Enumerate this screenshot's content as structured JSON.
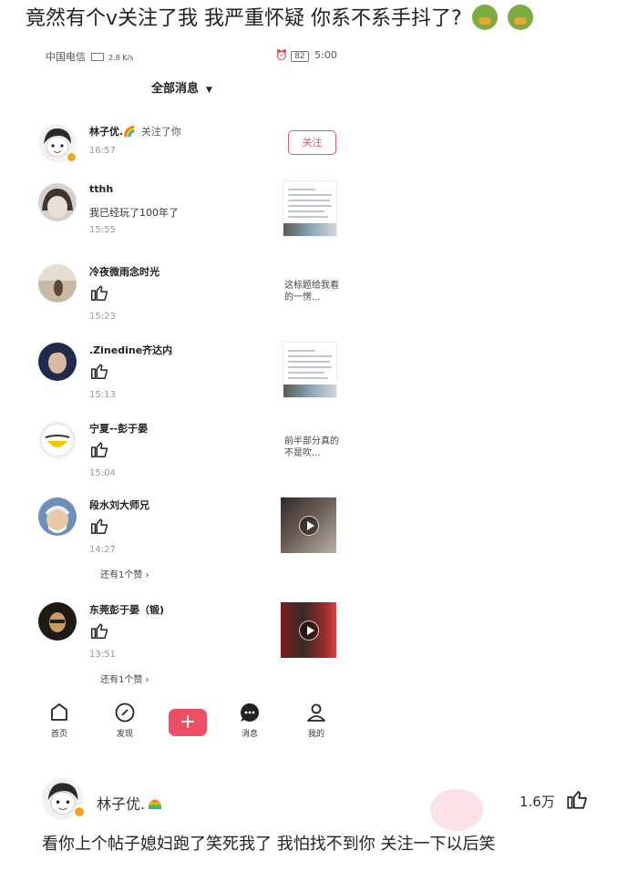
{
  "post": {
    "title": "竟然有个v关注了我 我严重怀疑 你系不系手抖了?",
    "emojis": [
      "dinosaur-emoji",
      "dinosaur-emoji"
    ]
  },
  "status_bar": {
    "carrier": "中国电信",
    "net_speed": "2.8 K/s",
    "battery": "82",
    "time": "5:00"
  },
  "header": {
    "filter_label": "全部消息"
  },
  "notifications": [
    {
      "user": "林子优.🌈",
      "action": "关注了你",
      "time": "16:57",
      "button": "关注",
      "verified": true
    },
    {
      "user": "tthh",
      "comment": "我已经玩了100年了",
      "time": "15:55",
      "thumb": "screenshot"
    },
    {
      "user": "冷夜微雨念时光",
      "type": "like",
      "time": "15:23",
      "thumb_text": "这标题给我看的一愣..."
    },
    {
      "user": ".Zinedine齐达内",
      "type": "like",
      "time": "15:13",
      "thumb": "screenshot"
    },
    {
      "user": "宁夏--彭于晏",
      "type": "like",
      "time": "15:04",
      "thumb_text": "前半部分真的不是吹..."
    },
    {
      "user": "段水刘大师兄",
      "type": "like",
      "time": "14:27",
      "more": "还有1个赞 ›",
      "thumb": "video"
    },
    {
      "user": "东莞彭于晏（锻)",
      "type": "like",
      "time": "13:51",
      "more": "还有1个赞 ›",
      "thumb": "video"
    }
  ],
  "tabbar": {
    "home": "首页",
    "discover": "发现",
    "plus": "+",
    "messages": "消息",
    "me": "我的"
  },
  "reply": {
    "user": "林子优.",
    "likes": "1.6万",
    "text": "看你上个帖子媳妇跑了笑死我了 我怕找不到你 关注一下以后笑"
  },
  "colors": {
    "accent": "#ee4f66",
    "verified": "#f3a51f"
  }
}
